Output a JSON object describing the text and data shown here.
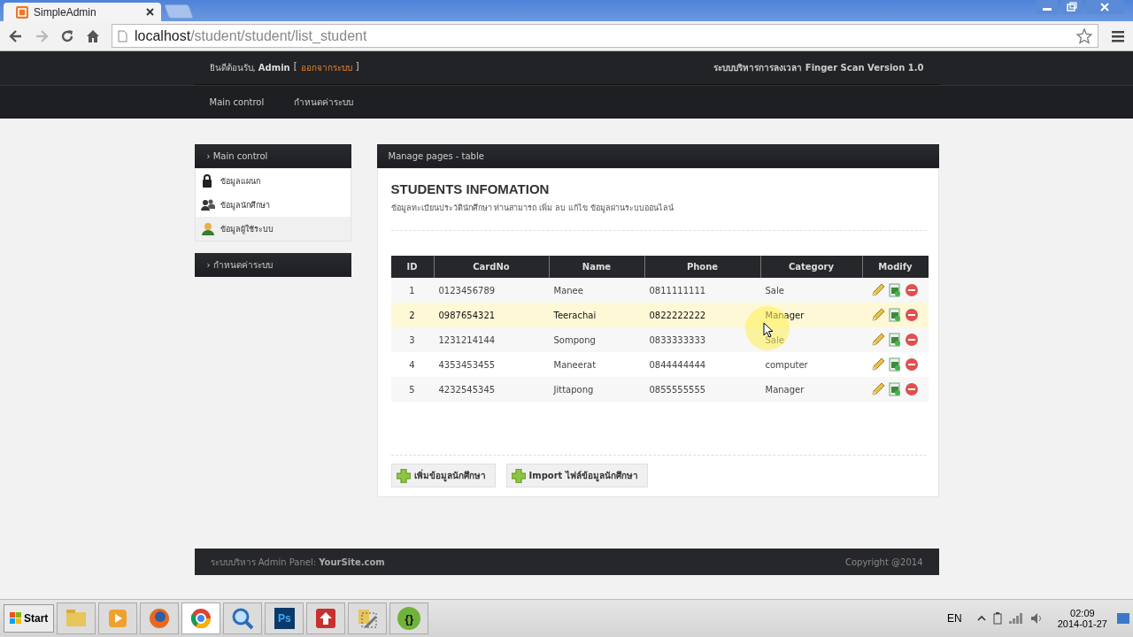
{
  "browser": {
    "tab_title": "SimpleAdmin",
    "url_host": "localhost",
    "url_path": "/student/student/list_student"
  },
  "header": {
    "welcome": "ยินดีต้อนรับ, **Admin**",
    "bracket_open": "[",
    "logout_link": "ออกจากระบบ",
    "bracket_close": "]",
    "system_title": "ระบบบริหารการลงเวลา Finger Scan Version 1.0"
  },
  "nav": [
    {
      "label": "Main control"
    },
    {
      "label": "กำหนดค่าระบบ"
    }
  ],
  "sidebar": [
    {
      "title": "› Main control",
      "items": [
        {
          "label": "ข้อมูลแผนก",
          "kind": "lock",
          "selected": false
        },
        {
          "label": "ข้อมูลนักศึกษา",
          "kind": "users",
          "selected": false
        },
        {
          "label": "ข้อมูลผู้ใช้ระบบ",
          "kind": "user",
          "selected": true
        }
      ]
    },
    {
      "title": "› กำหนดค่าระบบ"
    }
  ],
  "main": {
    "panel_title": "Manage pages - table",
    "heading": "STUDENTS INFOMATION",
    "description": "ข้อมูลทะเบียนประวัตินักศึกษา ท่านสามารถ เพิ่ม ลบ แก้ไข ข้อมูลผ่านระบบออนไลน์",
    "table": {
      "columns": [
        "ID",
        "CardNo",
        "Name",
        "Phone",
        "Category",
        "Modify"
      ],
      "rows": [
        {
          "cells": [
            "1",
            "0123456789",
            "Manee",
            "0811111111",
            "Sale"
          ],
          "highlighted": false
        },
        {
          "cells": [
            "2",
            "0987654321",
            "Teerachai",
            "0822222222",
            "Manager"
          ],
          "highlighted": true
        },
        {
          "cells": [
            "3",
            "1231214144",
            "Sompong",
            "0833333333",
            "Sale"
          ],
          "highlighted": false
        },
        {
          "cells": [
            "4",
            "4353453455",
            "Maneerat",
            "0844444444",
            "computer"
          ],
          "highlighted": false
        },
        {
          "cells": [
            "5",
            "4232545345",
            "Jittapong",
            "0855555555",
            "Manager"
          ],
          "highlighted": false
        }
      ]
    },
    "buttons": [
      {
        "label": "เพิ่มข้อมูลนักศึกษา"
      },
      {
        "label": "Import ไฟล์ข้อมูลนักศึกษา"
      }
    ]
  },
  "footer": {
    "left": "ระบบบริหาร Admin Panel: **YourSite.com**",
    "right": "Copyright @2014"
  },
  "taskbar": {
    "start": "Start",
    "apps": [
      {
        "kind": "folder",
        "selected": false
      },
      {
        "kind": "media",
        "selected": false
      },
      {
        "kind": "firefox",
        "selected": false
      },
      {
        "kind": "chrome",
        "selected": true
      },
      {
        "kind": "search",
        "selected": false
      },
      {
        "kind": "ps",
        "label": "Ps",
        "selected": false
      },
      {
        "kind": "upload",
        "selected": false
      },
      {
        "kind": "tools",
        "selected": false
      },
      {
        "kind": "braces",
        "label": "{}",
        "selected": false
      }
    ],
    "language": "EN",
    "time": "02:09",
    "date": "2014-01-27"
  }
}
